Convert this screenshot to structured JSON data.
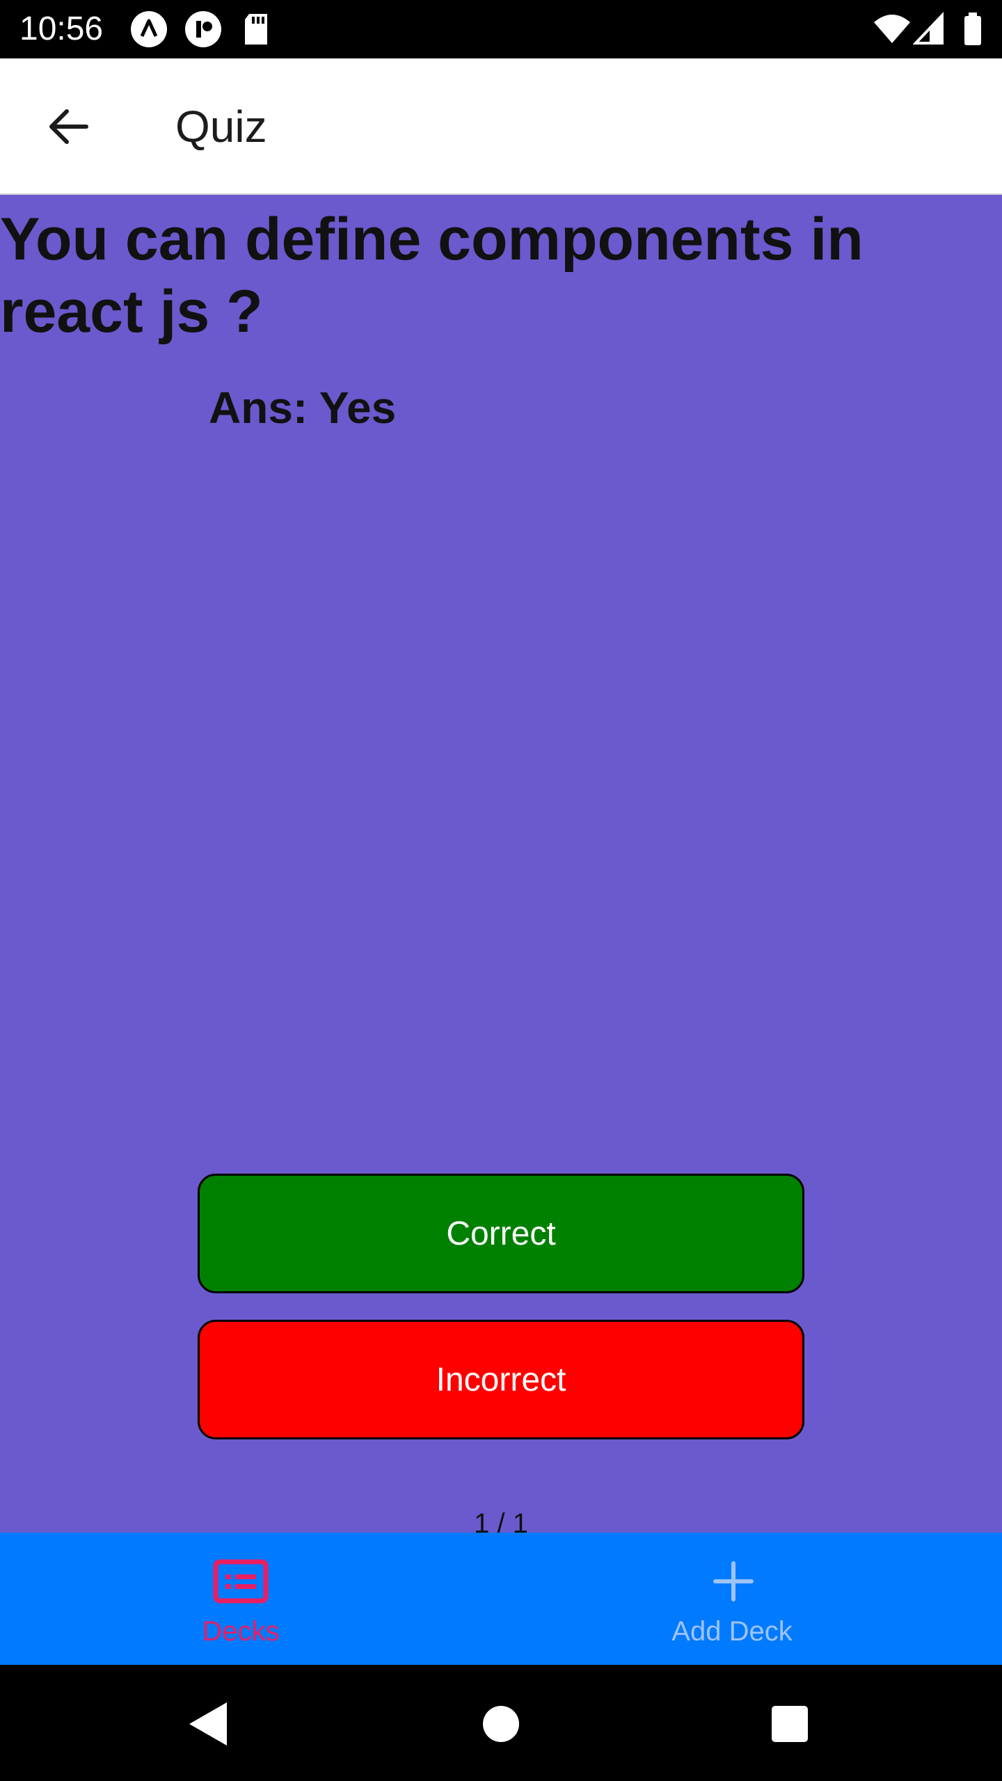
{
  "status_bar": {
    "time": "10:56"
  },
  "app_bar": {
    "title": "Quiz"
  },
  "card": {
    "question": "You can define components in react js ?",
    "answer": "Ans: Yes"
  },
  "actions": {
    "correct_label": "Correct",
    "incorrect_label": "Incorrect"
  },
  "progress": {
    "text": "1 / 1"
  },
  "tabs": [
    {
      "label": "Decks",
      "icon": "cards-icon",
      "active": true
    },
    {
      "label": "Add Deck",
      "icon": "plus-icon",
      "active": false
    }
  ],
  "colors": {
    "background": "#6a5acd",
    "correct": "#008000",
    "incorrect": "#ff0000",
    "tab_bar": "#007aff",
    "tab_active": "#e91e63",
    "tab_inactive": "#9ec3f5"
  }
}
